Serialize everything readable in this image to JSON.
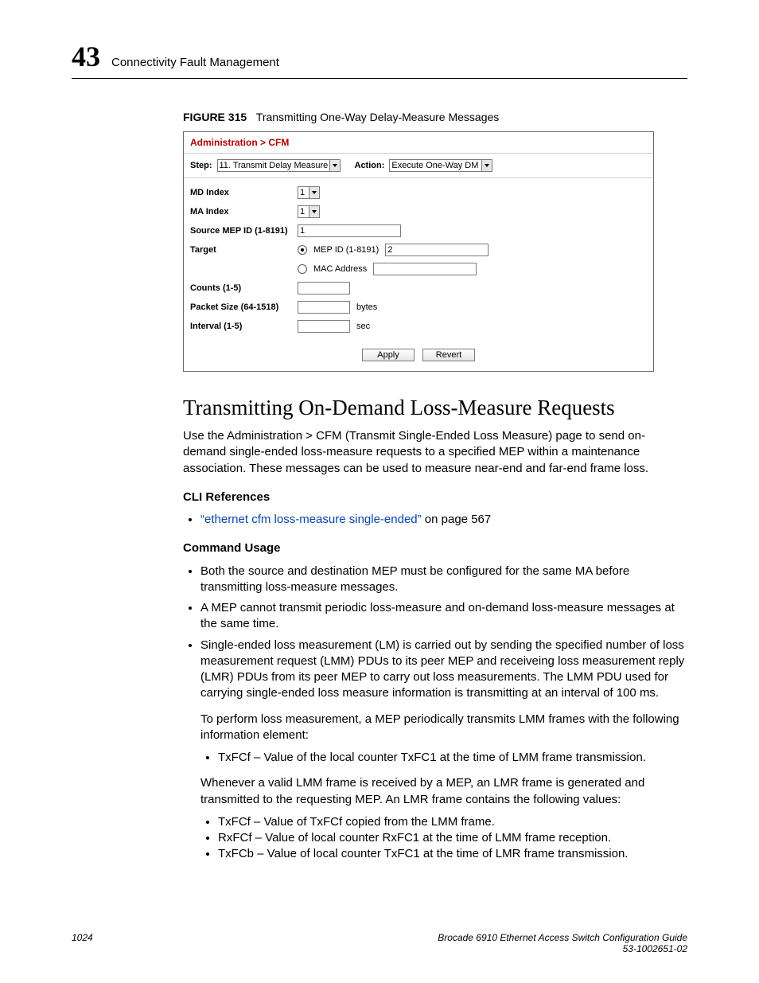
{
  "header": {
    "chapter_number": "43",
    "chapter_title": "Connectivity Fault Management"
  },
  "figure": {
    "label": "FIGURE 315",
    "caption": "Transmitting One-Way Delay-Measure Messages"
  },
  "screenshot": {
    "breadcrumb": "Administration > CFM",
    "step_label": "Step:",
    "step_value": "11. Transmit Delay Measure",
    "action_label": "Action:",
    "action_value": "Execute One-Way DM",
    "fields": {
      "md_index": {
        "label": "MD Index",
        "value": "1"
      },
      "ma_index": {
        "label": "MA Index",
        "value": "1"
      },
      "source_mep": {
        "label": "Source MEP ID (1-8191)",
        "value": "1"
      },
      "target": {
        "label": "Target",
        "mepid_label": "MEP ID (1-8191)",
        "mepid_value": "2",
        "mac_label": "MAC Address",
        "mac_value": ""
      },
      "counts": {
        "label": "Counts (1-5)",
        "value": ""
      },
      "packet_size": {
        "label": "Packet Size (64-1518)",
        "value": "",
        "unit": "bytes"
      },
      "interval": {
        "label": "Interval (1-5)",
        "value": "",
        "unit": "sec"
      }
    },
    "buttons": {
      "apply": "Apply",
      "revert": "Revert"
    }
  },
  "section": {
    "title": "Transmitting On-Demand Loss-Measure Requests",
    "intro": "Use the Administration > CFM (Transmit Single-Ended Loss Measure) page to send on-demand single-ended loss-measure requests to a specified MEP within a maintenance association. These messages can be used to measure near-end and far-end frame loss.",
    "cli_refs_heading": "CLI References",
    "cli_link_text": "“ethernet cfm loss-measure single-ended”",
    "cli_link_suffix": " on page 567",
    "cmd_usage_heading": "Command Usage",
    "bullets": [
      "Both the source and destination MEP must be configured for the same MA before transmitting loss-measure messages.",
      "A MEP cannot transmit periodic loss-measure and on-demand loss-measure messages at the same time.",
      "Single-ended loss measurement (LM) is carried out by sending the specified number of loss measurement request (LMM) PDUs to its peer MEP and receiveing loss measurement reply (LMR) PDUs from its peer MEP to carry out loss measurements. The LMM PDU used for carrying single-ended loss measure information is transmitting at an interval of 100 ms."
    ],
    "para_after_b3": "To perform loss measurement, a MEP periodically transmits LMM frames with the following information element:",
    "sub1": [
      "TxFCf – Value of the local counter TxFC1 at the time of LMM frame transmission."
    ],
    "para_after_sub1": "Whenever a valid LMM frame is received by a MEP, an LMR frame is generated and transmitted to the requesting MEP. An LMR frame contains the following values:",
    "sub2": [
      "TxFCf – Value of TxFCf copied from the LMM frame.",
      "RxFCf – Value of local counter RxFC1 at the time of LMM frame reception.",
      "TxFCb – Value of local counter TxFC1 at the time of LMR frame transmission."
    ]
  },
  "footer": {
    "page": "1024",
    "guide": "Brocade 6910 Ethernet Access Switch Configuration Guide",
    "docnum": "53-1002651-02"
  }
}
